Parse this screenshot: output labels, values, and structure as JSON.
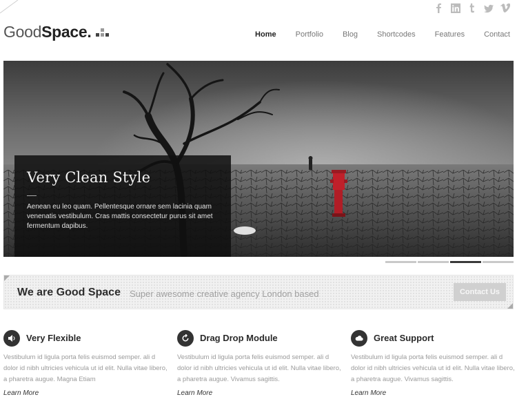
{
  "logo": {
    "light": "Good",
    "bold": "Space."
  },
  "social": [
    {
      "name": "facebook-icon"
    },
    {
      "name": "linkedin-icon"
    },
    {
      "name": "tumblr-icon"
    },
    {
      "name": "twitter-icon"
    },
    {
      "name": "vimeo-icon"
    }
  ],
  "nav": {
    "items": [
      {
        "label": "Home"
      },
      {
        "label": "Portfolio"
      },
      {
        "label": "Blog"
      },
      {
        "label": "Shortcodes"
      },
      {
        "label": "Features"
      },
      {
        "label": "Contact"
      }
    ],
    "active": "Home"
  },
  "slider": {
    "caption_title": "Very Clean Style",
    "caption_text": "Aenean eu leo quam. Pellentesque ornare sem lacinia quam venenatis vestibulum. Cras mattis consectetur purus sit amet fermentum dapibus.",
    "slide_count": 4,
    "active_slide": 3
  },
  "banner": {
    "title": "We are Good Space",
    "subtitle": "Super awesome creative agency London based",
    "button_label": "Contact Us"
  },
  "features": [
    {
      "icon": "speaker-icon",
      "title": "Very Flexible",
      "text": "Vestibulum id ligula porta felis euismod semper. ali d dolor id nibh ultricies vehicula ut id elit. Nulla vitae libero, a pharetra augue. Magna Etiam",
      "link": "Learn More"
    },
    {
      "icon": "refresh-icon",
      "title": "Drag Drop Module",
      "text": "Vestibulum id ligula porta felis euismod semper. ali d dolor id nibh ultricies vehicula ut id elit. Nulla vitae libero, a pharetra augue. Vivamus sagittis.",
      "link": "Learn More"
    },
    {
      "icon": "cloud-icon",
      "title": "Great Support",
      "text": "Vestibulum id ligula porta felis euismod semper. ali d dolor id nibh ultricies vehicula ut id elit. Nulla vitae libero, a pharetra augue. Vivamus sagittis.",
      "link": "Learn More"
    }
  ],
  "colors": {
    "accent_dark": "#333333",
    "hydrant_red": "#c0202a",
    "banner_button": "#d0d0d0"
  }
}
